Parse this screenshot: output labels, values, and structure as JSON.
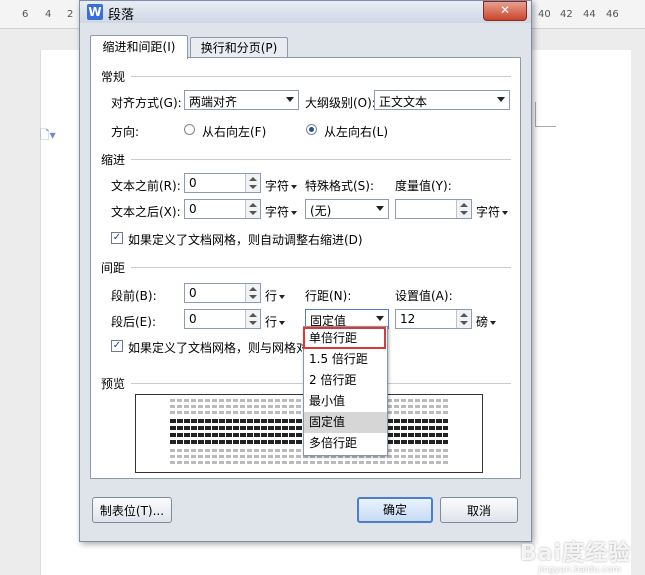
{
  "ruler": {
    "left_numbers": [
      "6",
      "4",
      "2"
    ],
    "right_numbers": [
      "40",
      "42",
      "44",
      "46"
    ]
  },
  "dialog": {
    "title": "段落",
    "app_icon_letter": "W",
    "close_glyph": "✕",
    "tabs": [
      {
        "label": "缩进和间距(I)",
        "active": true
      },
      {
        "label": "换行和分页(P)",
        "active": false
      }
    ],
    "general": {
      "section": "常规",
      "alignment_label": "对齐方式(G):",
      "alignment_value": "两端对齐",
      "outline_label": "大纲级别(O):",
      "outline_value": "正文文本",
      "direction_label": "方向:",
      "rtl_label": "从右向左(F)",
      "ltr_label": "从左向右(L)",
      "direction_selected": "ltr"
    },
    "indent": {
      "section": "缩进",
      "before_label": "文本之前(R):",
      "before_value": "0",
      "before_unit": "字符",
      "after_label": "文本之后(X):",
      "after_value": "0",
      "after_unit": "字符",
      "special_label": "特殊格式(S):",
      "special_value": "(无)",
      "measure_label": "度量值(Y):",
      "measure_value": "",
      "measure_unit": "字符",
      "grid_checkbox_label": "如果定义了文档网格，则自动调整右缩进(D)",
      "grid_checked": true
    },
    "spacing": {
      "section": "间距",
      "before_label": "段前(B):",
      "before_value": "0",
      "before_unit": "行",
      "after_label": "段后(E):",
      "after_value": "0",
      "after_unit": "行",
      "line_label": "行距(N):",
      "line_value": "固定值",
      "setting_label": "设置值(A):",
      "setting_value": "12",
      "setting_unit": "磅",
      "grid_checkbox_label": "如果定义了文档网格，则与网格对",
      "grid_checked": true
    },
    "line_spacing_options": [
      "单倍行距",
      "1.5 倍行距",
      "2 倍行距",
      "最小值",
      "固定值",
      "多倍行距"
    ],
    "line_spacing_hover": "固定值",
    "line_spacing_highlighted": "单倍行距",
    "preview": {
      "section": "预览"
    },
    "buttons": {
      "tabs": "制表位(T)...",
      "ok": "确定",
      "cancel": "取消"
    }
  },
  "watermark": {
    "main": "Bai度经验",
    "sub": "jingyan.baidu.com"
  }
}
